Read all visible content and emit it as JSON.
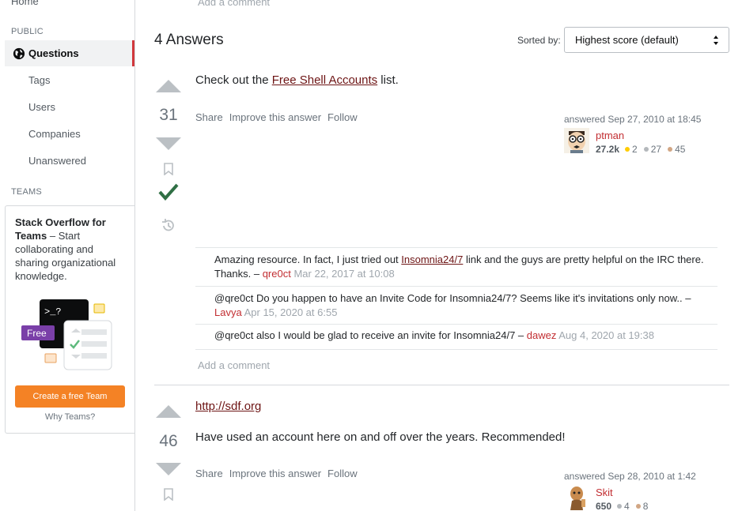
{
  "sidebar": {
    "home": "Home",
    "public_label": "PUBLIC",
    "questions": "Questions",
    "tags": "Tags",
    "users": "Users",
    "companies": "Companies",
    "unanswered": "Unanswered",
    "teams_label": "TEAMS",
    "teams_title": "Stack Overflow for Teams",
    "teams_desc": " – Start collaborating and sharing organizational knowledge.",
    "teams_free_badge": "Free",
    "teams_prompt": ">_?",
    "teams_button": "Create a free Team",
    "teams_why": "Why Teams?"
  },
  "header": {
    "add_comment_top": "Add a comment",
    "answers_count": "4 Answers",
    "sorted_by": "Sorted by:",
    "sort_value": "Highest score (default)"
  },
  "answers": [
    {
      "score": "31",
      "body_prefix": "Check out the ",
      "body_link": "Free Shell Accounts",
      "body_suffix": " list.",
      "menu": {
        "share": "Share",
        "improve": "Improve this answer",
        "follow": "Follow"
      },
      "answered_prefix": "answered ",
      "answered_time": "Sep 27, 2010 at 18:45",
      "user": {
        "name": "ptman",
        "rep": "27.2k",
        "gold": "2",
        "silver": "27",
        "bronze": "45"
      },
      "accepted": true
    },
    {
      "score": "46",
      "link_line": "http://sdf.org",
      "body": "Have used an account here on and off over the years. Recommended!",
      "menu": {
        "share": "Share",
        "improve": "Improve this answer",
        "follow": "Follow"
      },
      "answered_prefix": "answered ",
      "answered_time": "Sep 28, 2010 at 1:42",
      "user": {
        "name": "Skit",
        "rep": "650",
        "silver": "4",
        "bronze": "8"
      }
    }
  ],
  "comments": [
    {
      "text_a": "Amazing resource. In fact, I just tried out ",
      "link": "Insomnia24/7",
      "text_b": " link and the guys are pretty helpful on the IRC there. Thanks. – ",
      "user": "qre0ct",
      "date": "Mar 22, 2017 at 10:08"
    },
    {
      "text_a": "@qre0ct Do you happen to have an Invite Code for Insomnia24/7? Seems like it's invitations only now.. – ",
      "user": "Lavya",
      "date": "Apr 15, 2020 at 6:55"
    },
    {
      "text_a": "@qre0ct also I would be glad to receive an invite for Insomnia24/7 – ",
      "user": "dawez",
      "date": "Aug 4, 2020 at 19:38"
    }
  ],
  "add_comment": "Add a comment",
  "colors": {
    "accent_nav": "#d1383d",
    "user_link": "#c22e32",
    "accepted_check": "#2f6f44",
    "teams_button": "#f48225"
  }
}
